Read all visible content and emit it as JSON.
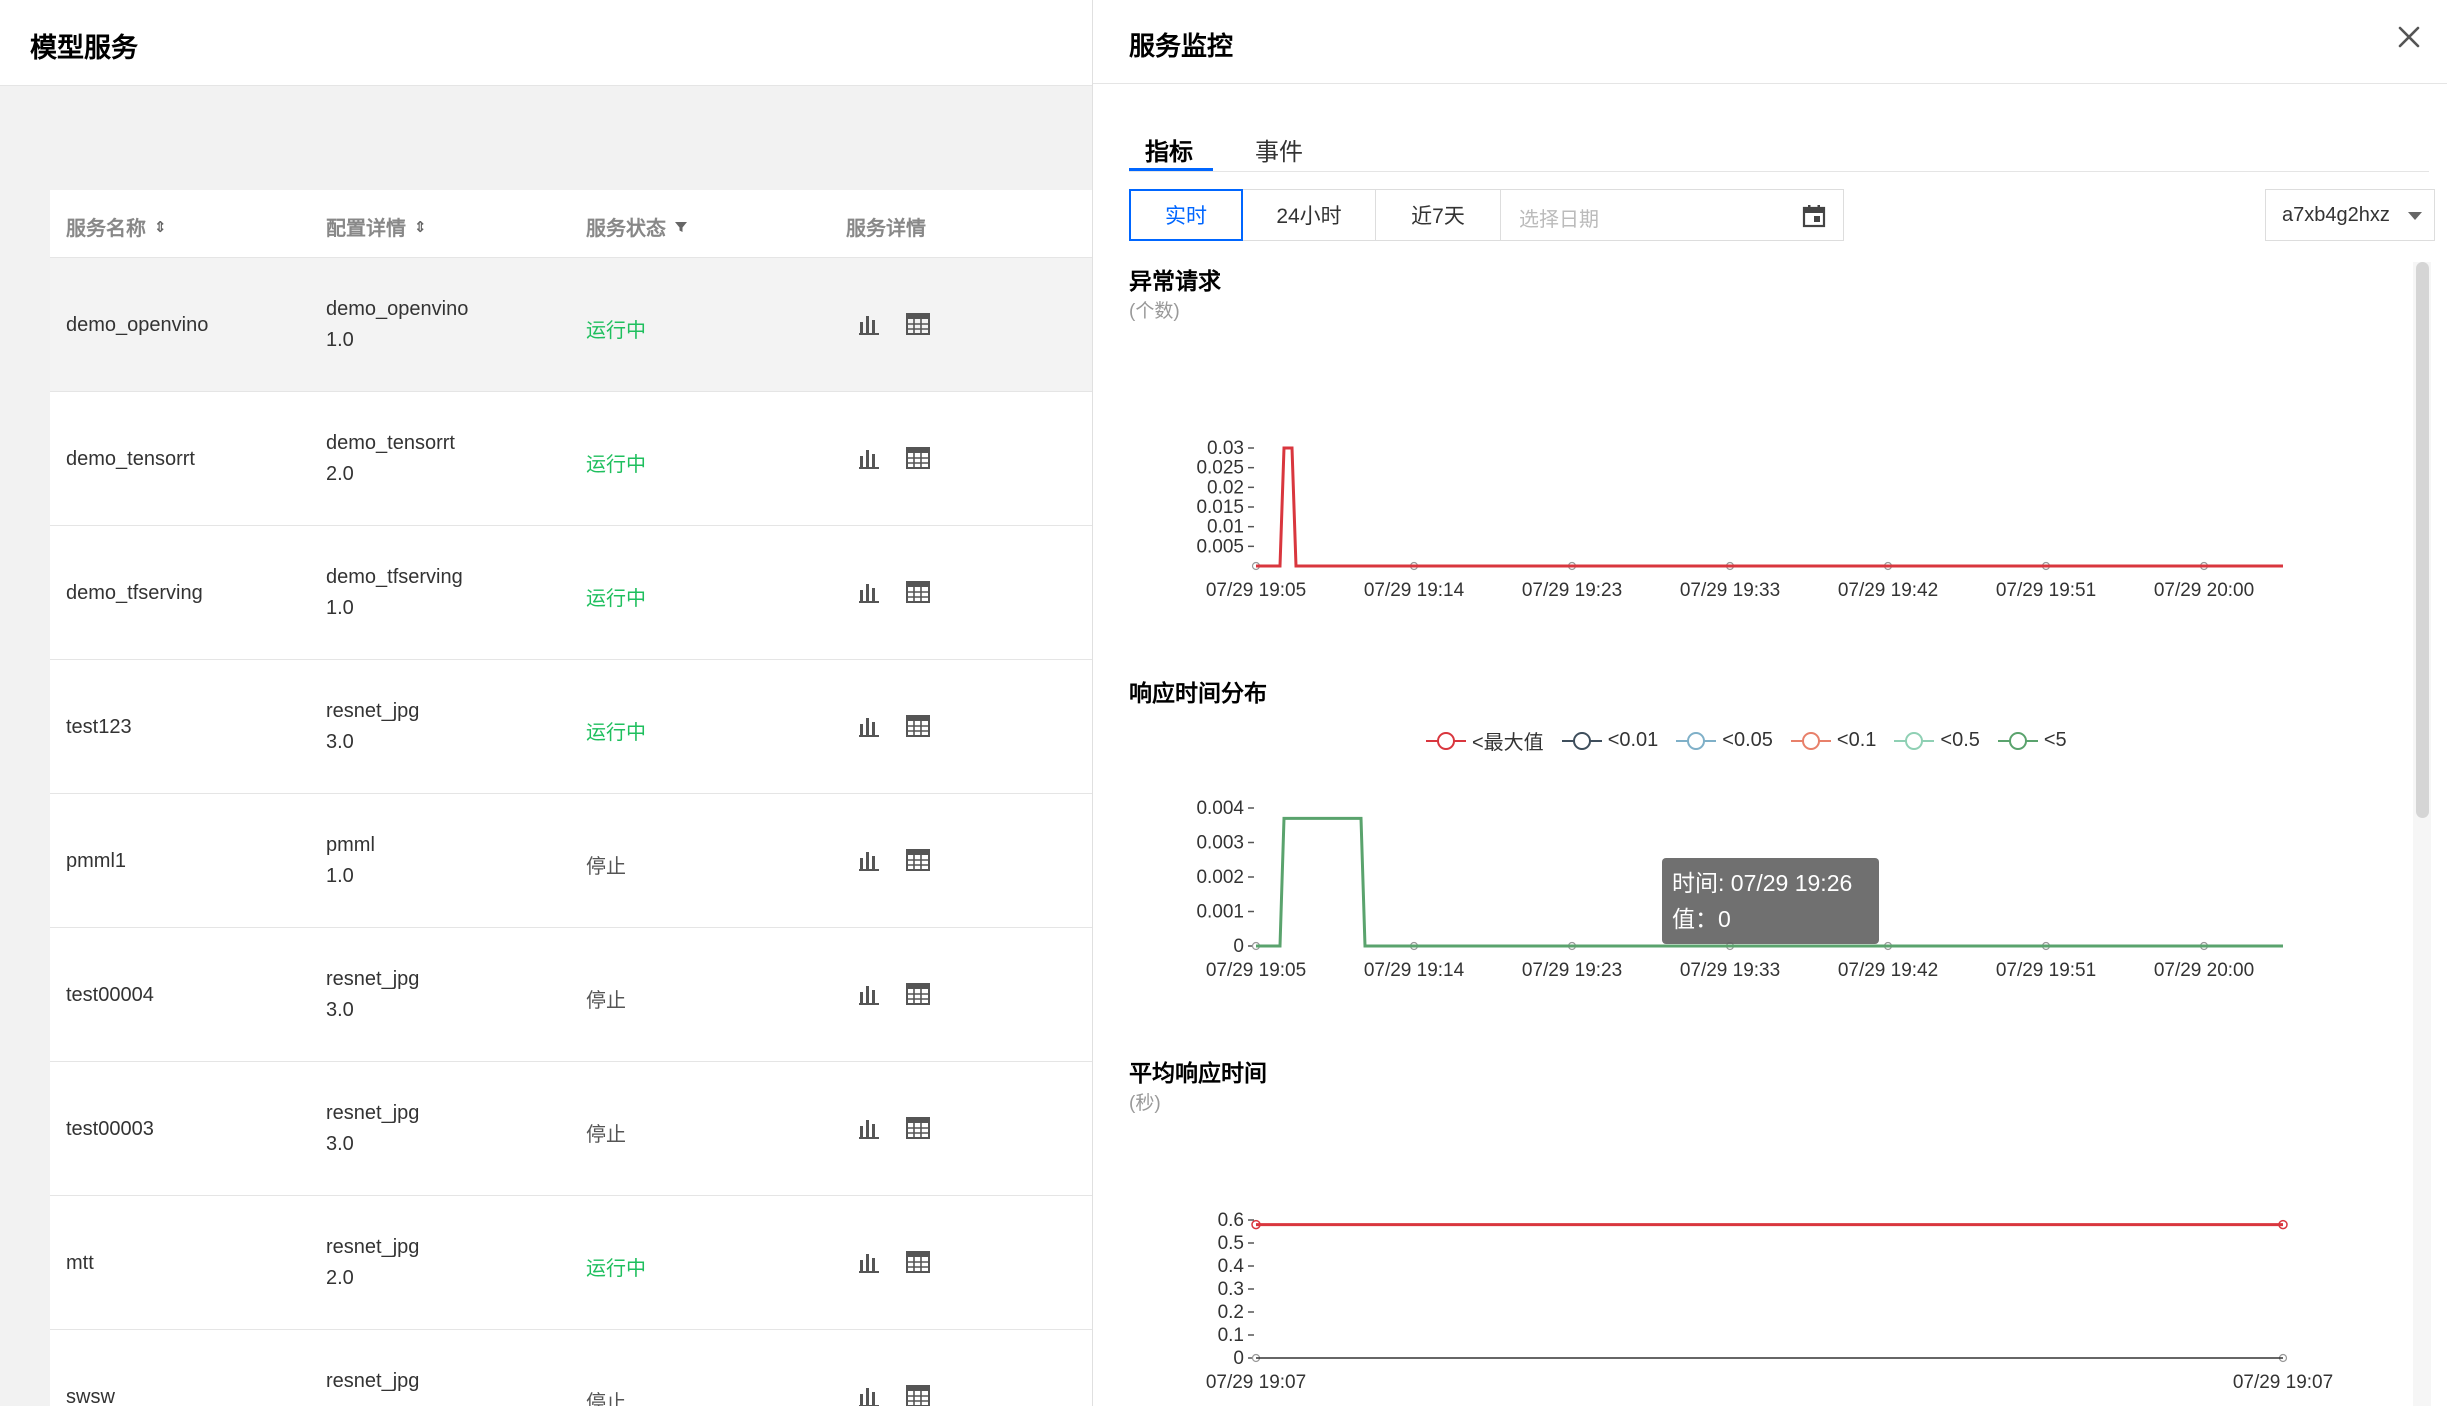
{
  "page": {
    "title": "模型服务"
  },
  "table": {
    "headers": {
      "name": "服务名称",
      "config": "配置详情",
      "status": "服务状态",
      "details": "服务详情"
    },
    "rows": [
      {
        "name": "demo_openvino",
        "config": "demo_openvino",
        "version": "1.0",
        "status": "运行中",
        "state": "run"
      },
      {
        "name": "demo_tensorrt",
        "config": "demo_tensorrt",
        "version": "2.0",
        "status": "运行中",
        "state": "run"
      },
      {
        "name": "demo_tfserving",
        "config": "demo_tfserving",
        "version": "1.0",
        "status": "运行中",
        "state": "run"
      },
      {
        "name": "test123",
        "config": "resnet_jpg",
        "version": "3.0",
        "status": "运行中",
        "state": "run"
      },
      {
        "name": "pmml1",
        "config": "pmml",
        "version": "1.0",
        "status": "停止",
        "state": "stop"
      },
      {
        "name": "test00004",
        "config": "resnet_jpg",
        "version": "3.0",
        "status": "停止",
        "state": "stop"
      },
      {
        "name": "test00003",
        "config": "resnet_jpg",
        "version": "3.0",
        "status": "停止",
        "state": "stop"
      },
      {
        "name": "mtt",
        "config": "resnet_jpg",
        "version": "2.0",
        "status": "运行中",
        "state": "run"
      },
      {
        "name": "swsw",
        "config": "resnet_jpg",
        "version": "",
        "status": "停止",
        "state": "stop"
      }
    ]
  },
  "drawer": {
    "title": "服务监控",
    "tabs": [
      "指标",
      "事件"
    ],
    "active_tab": "指标",
    "ranges": [
      "实时",
      "24小时",
      "近7天"
    ],
    "active_range": "实时",
    "date_placeholder": "选择日期",
    "instance": "a7xb4g2hxz",
    "sections": {
      "errors": {
        "title": "异常请求",
        "unit": "(个数)"
      },
      "latency_dist": {
        "title": "响应时间分布"
      },
      "avg_latency": {
        "title": "平均响应时间",
        "unit": "(秒)"
      }
    },
    "tooltip": {
      "time": "时间: 07/29 19:26",
      "value": "值：0"
    }
  },
  "colors": {
    "accent": "#0066ff",
    "running": "#1fbf5e",
    "red_line": "#d9363e",
    "green_line": "#5aa36d"
  },
  "chart_data": [
    {
      "type": "line",
      "title": "异常请求",
      "ylabel": "(个数)",
      "x": [
        "07/29 19:05",
        "07/29 19:14",
        "07/29 19:23",
        "07/29 19:33",
        "07/29 19:42",
        "07/29 19:51",
        "07/29 20:00"
      ],
      "y_ticks": [
        "0.005",
        "0.01",
        "0.015",
        "0.02",
        "0.025",
        "0.03"
      ],
      "ylim": [
        0,
        0.03
      ],
      "series": [
        {
          "values": [
            0,
            0,
            0,
            0,
            0,
            0,
            0
          ],
          "spike": {
            "near_x": "07/29 19:05",
            "value": 0.03
          },
          "color": "#d9363e"
        }
      ]
    },
    {
      "type": "line",
      "title": "响应时间分布",
      "legend": [
        "<最大值",
        "<0.01",
        "<0.05",
        "<0.1",
        "<0.5",
        "<5"
      ],
      "legend_colors": [
        "#d9363e",
        "#3e4e5c",
        "#7fb0c8",
        "#e8806a",
        "#8fd0b4",
        "#5aa36d"
      ],
      "x": [
        "07/29 19:05",
        "07/29 19:14",
        "07/29 19:23",
        "07/29 19:33",
        "07/29 19:42",
        "07/29 19:51",
        "07/29 20:00"
      ],
      "y_ticks": [
        "0",
        "0.001",
        "0.002",
        "0.003",
        "0.004"
      ],
      "ylim": [
        0,
        0.004
      ],
      "series": [
        {
          "name": "<5",
          "values": [
            0,
            0,
            0,
            0,
            0,
            0,
            0
          ],
          "plateau": {
            "from": "07/29 19:05",
            "value": 0.0037
          },
          "color": "#5aa36d"
        }
      ]
    },
    {
      "type": "line",
      "title": "平均响应时间",
      "ylabel": "(秒)",
      "x": [
        "07/29 19:07",
        "07/29 19:07"
      ],
      "y_ticks": [
        "0",
        "0.1",
        "0.2",
        "0.3",
        "0.4",
        "0.5",
        "0.6"
      ],
      "ylim": [
        0,
        0.6
      ],
      "series": [
        {
          "values": [
            0.58,
            0.58
          ],
          "color": "#d9363e"
        }
      ]
    }
  ]
}
